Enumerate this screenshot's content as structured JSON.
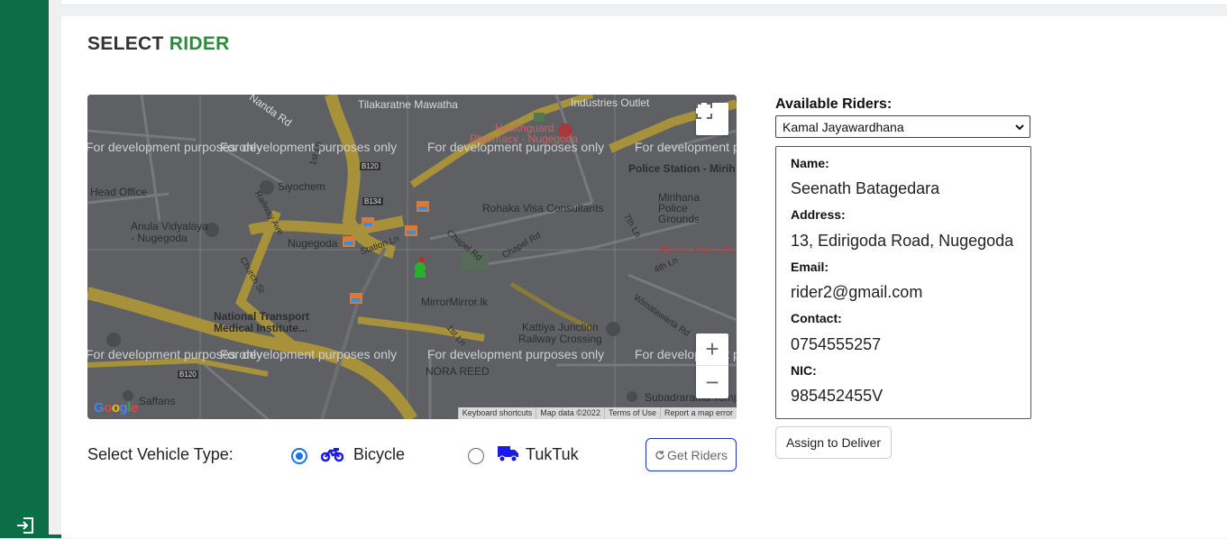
{
  "page": {
    "title_prefix": "SELECT",
    "title_accent": "RIDER"
  },
  "map": {
    "dev_watermark": "For development purposes only",
    "labels": {
      "tilakaratne": "Tilakaratne Mawatha",
      "industries": "Industries Outlet",
      "nanda": "Nanda Rd",
      "healthguard": "Healthguard",
      "pharmacy": "Pharmacy - Nugegoda",
      "police": "Police Station - Mirih",
      "head_office": "Head Office",
      "siyochem": "Siyochem",
      "mirihana": "Mirihana",
      "police2": "Police",
      "grounds": "Grounds",
      "rohaka": "Rohaka Visa Consultants",
      "anula1": "Anula Vidyalaya",
      "anula2": "- Nugegoda",
      "nugegoda": "Nugegoda",
      "station": "Station Ln",
      "chapel": "Chapel Rd",
      "chapel2": "Chapel Rd",
      "home_from": "Home From Ho",
      "seventh": "7th Ln",
      "fourth": "4th Ln",
      "church": "Church St",
      "mirror": "MirrorMirror.lk",
      "ntmi1": "National Transport",
      "ntmi2": "Medical Institute...",
      "kattiya1": "Kattiya Junction",
      "kattiya2": "Railway Crossing",
      "wimala": "Wimalawarta Rd",
      "first_ln": "1st Ln",
      "nora": "NORA REED",
      "saffans": "Saffans",
      "subadrarama": "Subadrarama Temp",
      "first_st": "1st Ln",
      "railway": "Railway Ave",
      "b120": "B120",
      "b134": "B134",
      "b120b": "B120"
    },
    "zoom_in": "+",
    "zoom_out": "−",
    "google": "Google",
    "attribution": [
      "Keyboard shortcuts",
      "Map data ©2022",
      "Terms of Use",
      "Report a map error"
    ]
  },
  "vehicle": {
    "label": "Select Vehicle Type:",
    "options": [
      {
        "label": "Bicycle",
        "icon": "motorcycle-icon",
        "selected": true
      },
      {
        "label": "TukTuk",
        "icon": "truck-icon",
        "selected": false
      }
    ],
    "get_riders": "Get Riders"
  },
  "riders": {
    "label": "Available Riders:",
    "selected": "Kamal Jayawardhana",
    "details": {
      "name_label": "Name:",
      "name": "Seenath Batagedara",
      "address_label": "Address:",
      "address": "13, Edirigoda Road, Nugegoda",
      "email_label": "Email:",
      "email": "rider2@gmail.com",
      "contact_label": "Contact:",
      "contact": "0754555257",
      "nic_label": "NIC:",
      "nic": "985452455V"
    },
    "assign_button": "Assign to Deliver"
  },
  "colors": {
    "sidebar": "#0b6e47",
    "accent": "#2e8b3e",
    "radio": "#1a73e8",
    "icon": "#1a1ae6"
  }
}
